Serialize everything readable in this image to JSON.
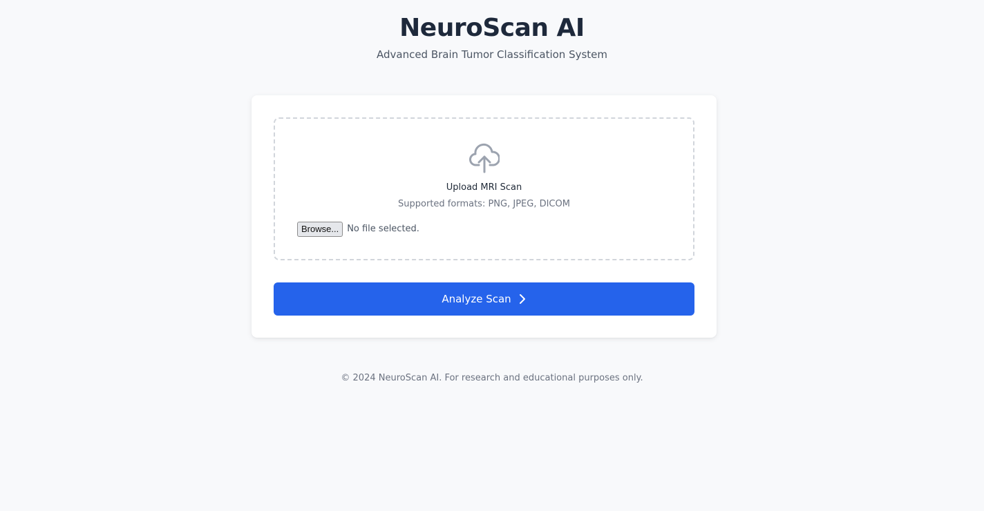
{
  "header": {
    "title": "NeuroScan AI",
    "subtitle": "Advanced Brain Tumor Classification System"
  },
  "upload": {
    "icon": "cloud-upload-icon",
    "title": "Upload MRI Scan",
    "formats": "Supported formats: PNG, JPEG, DICOM",
    "browse_label": "Browse...",
    "file_status": "No file selected."
  },
  "actions": {
    "analyze_label": "Analyze Scan",
    "analyze_icon": "chevron-right-icon"
  },
  "footer": {
    "text": "© 2024 NeuroScan AI. For research and educational purposes only."
  },
  "colors": {
    "primary": "#2563eb",
    "background": "#f8f9fb",
    "title": "#1e293b"
  }
}
